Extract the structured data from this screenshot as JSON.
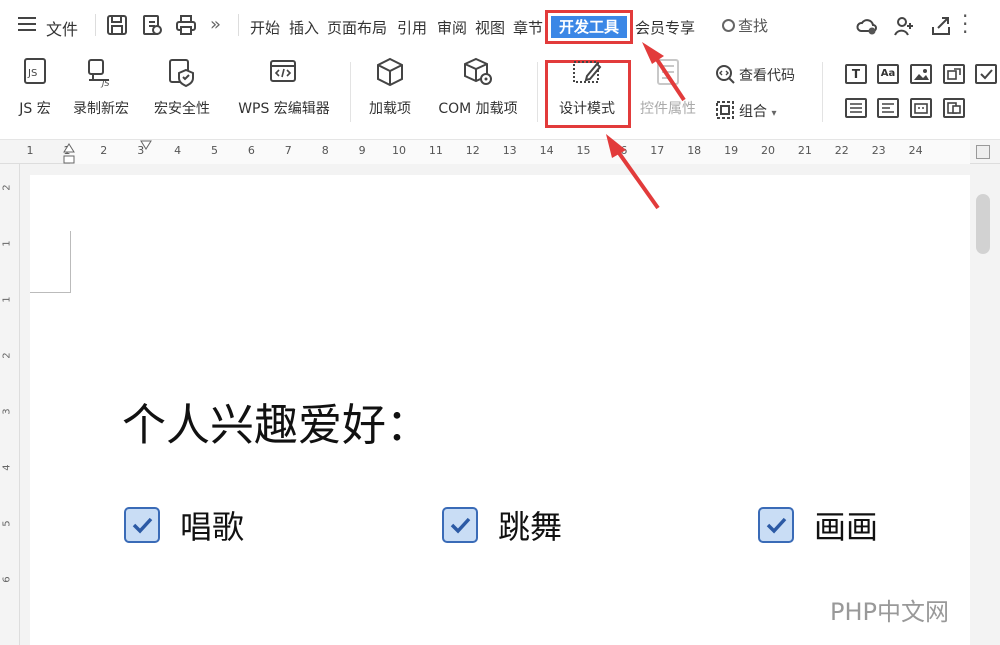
{
  "menubar": {
    "file_label": "文件",
    "tabs": [
      "开始",
      "插入",
      "页面布局",
      "引用",
      "审阅",
      "视图",
      "章节"
    ],
    "active_tab": "开发工具",
    "tab_after": "会员专享",
    "search_label": "查找"
  },
  "ribbon": {
    "js_macro": "JS 宏",
    "record_macro": "录制新宏",
    "macro_security": "宏安全性",
    "wps_macro_editor": "WPS 宏编辑器",
    "addins": "加载项",
    "com_addins": "COM 加载项",
    "design_mode": "设计模式",
    "control_properties": "控件属性",
    "view_code": "查看代码",
    "group": "组合"
  },
  "ruler": {
    "ticks": [
      "1",
      "1",
      "2",
      "3",
      "4",
      "5",
      "6",
      "7",
      "8",
      "9",
      "10",
      "11",
      "12",
      "13",
      "14",
      "15",
      "16",
      "17",
      "18",
      "19",
      "20",
      "21",
      "22",
      "23",
      "24"
    ],
    "vticks": [
      "2",
      "1",
      "1",
      "2",
      "3",
      "4",
      "5",
      "6"
    ]
  },
  "document": {
    "title": "个人兴趣爱好：",
    "checkboxes": [
      {
        "label": "唱歌",
        "checked": true
      },
      {
        "label": "跳舞",
        "checked": true
      },
      {
        "label": "画画",
        "checked": true
      }
    ]
  },
  "watermark": "PHP中文网",
  "colors": {
    "accent": "#3b87e6",
    "highlight": "#e23b3b",
    "checkbox_fill": "#c9ddf5",
    "checkbox_border": "#3a6bb7"
  }
}
